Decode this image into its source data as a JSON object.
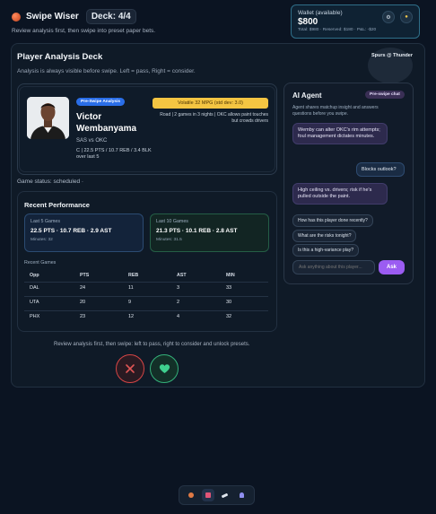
{
  "header": {
    "app_title": "Swipe Wiser",
    "deck_label": "Deck: 4/4",
    "tagline": "Review analysis first, then swipe into preset paper bets."
  },
  "wallet": {
    "label": "Wallet (available)",
    "amount": "$800",
    "summary": "Total: $980 · Reserved: $180 · P&L: -$20"
  },
  "deck": {
    "title": "Player Analysis Deck",
    "description": "Analysis is always visible before swipe. Left = pass, Right = consider.",
    "matchup": "Spurs @ Thunder"
  },
  "player": {
    "badge": "Pre-Swipe Analysis",
    "first_name": "Victor",
    "last_name": "Wembanyama",
    "team_matchup": "SAS vs OKC",
    "stat_line": "C | 22.5 PTS / 10.7 REB / 3.4 BLK over last 5",
    "volatility": "Volatile 32 MPG (std dev: 3.0)",
    "note": "Road | 2 games in 3 nights | OKC allows paint touches but crowds drivers"
  },
  "game_status": "Game status: scheduled ·",
  "performance": {
    "title": "Recent Performance",
    "last5": {
      "label": "Last 5 Games",
      "line": "22.5 PTS · 10.7 REB · 2.9 AST",
      "minutes": "Minutes: 32"
    },
    "last10": {
      "label": "Last 10 Games",
      "line": "21.3 PTS · 10.1 REB · 2.8 AST",
      "minutes": "Minutes: 31.5"
    },
    "recent_label": "Recent Games",
    "columns": [
      "Opp",
      "PTS",
      "REB",
      "AST",
      "MIN"
    ],
    "rows": [
      [
        "DAL",
        "24",
        "11",
        "3",
        "33"
      ],
      [
        "UTA",
        "20",
        "9",
        "2",
        "30"
      ],
      [
        "PHX",
        "23",
        "12",
        "4",
        "32"
      ]
    ]
  },
  "instructions": "Review analysis first, then swipe: left to pass, right to consider and unlock presets.",
  "agent": {
    "title": "AI Agent",
    "chip": "Pre-swipe chat",
    "description": "Agent shares matchup insight and answers questions before you swipe.",
    "messages": [
      {
        "role": "agent",
        "text": "Wemby can alter OKC's rim attempts; foul management dictates minutes."
      },
      {
        "role": "user",
        "text": "Blocks outlook?"
      },
      {
        "role": "agent",
        "text": "High ceiling vs. drivers; risk if he's pulled outside the paint."
      }
    ],
    "suggestions": [
      "How has this player done recently?",
      "What are the risks tonight?",
      "Is this a high-variance play?"
    ],
    "input_placeholder": "Ask anything about this player...",
    "ask_label": "Ask"
  },
  "colors": {
    "background": "#0b1422",
    "accent_purple": "#9b5cf2",
    "pass_red": "#d64545",
    "consider_green": "#34b27a",
    "volatility_yellow": "#f4c542",
    "badge_blue": "#2a6ee8"
  },
  "nav": {
    "items": [
      "basketball-icon",
      "deck-icon",
      "ticket-icon",
      "profile-icon"
    ]
  }
}
